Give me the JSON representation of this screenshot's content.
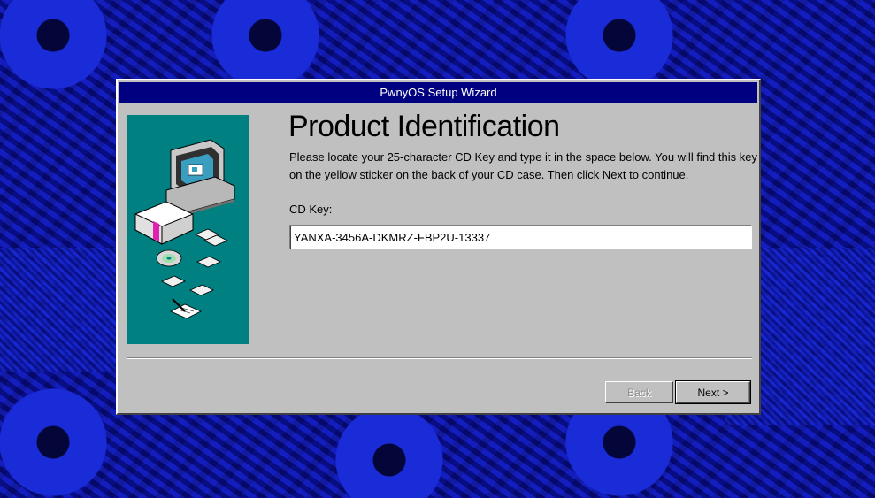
{
  "window": {
    "title": "PwnyOS Setup Wizard"
  },
  "page": {
    "heading": "Product Identification",
    "description": "Please locate your 25-character CD Key and type it in the space below. You will find this key on the yellow sticker on the back of your CD case. Then click Next to continue."
  },
  "cd_key": {
    "label": "CD Key:",
    "value": "YANXA-3456A-DKMRZ-FBP2U-13337"
  },
  "buttons": {
    "back_label": "Back",
    "back_enabled": false,
    "next_label": "Next >"
  },
  "colors": {
    "titlebar": "#000080",
    "window_face": "#c0c0c0",
    "side_panel": "#008080",
    "desktop": "#0d14a8"
  },
  "icons": [
    "computer-icon",
    "software-box-icon",
    "floppy-disk-icon",
    "cd-rom-icon",
    "document-pen-icon"
  ]
}
